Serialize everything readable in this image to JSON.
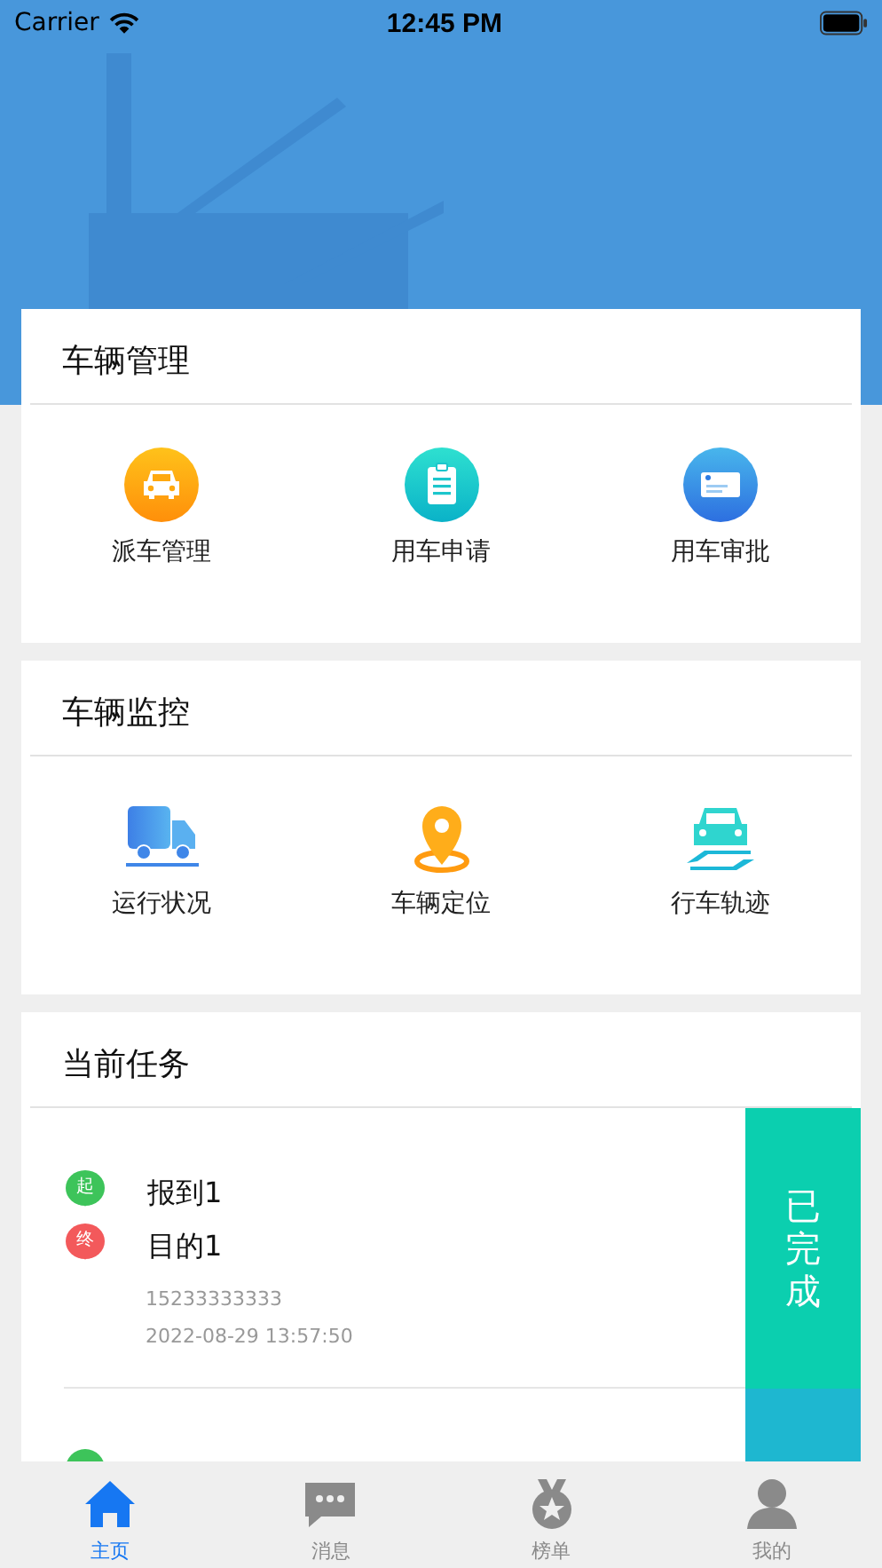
{
  "status_bar": {
    "carrier": "Carrier",
    "time": "12:45 PM"
  },
  "sections": [
    {
      "title": "车辆管理",
      "items": [
        {
          "label": "派车管理",
          "kind": "car"
        },
        {
          "label": "用车申请",
          "kind": "clipboard"
        },
        {
          "label": "用车审批",
          "kind": "card"
        }
      ]
    },
    {
      "title": "车辆监控",
      "items": [
        {
          "label": "运行状况",
          "kind": "truck"
        },
        {
          "label": "车辆定位",
          "kind": "pin"
        },
        {
          "label": "行车轨迹",
          "kind": "track"
        }
      ]
    }
  ],
  "tasks": {
    "title": "当前任务",
    "items": [
      {
        "start_marker": "起",
        "start": "报到1",
        "end_marker": "终",
        "end": "目的1",
        "phone": "15233333333",
        "time": "2022-08-29 13:57:50",
        "action": "已完成"
      }
    ]
  },
  "tab_bar": [
    {
      "label": "主页",
      "kind": "home",
      "selected": true
    },
    {
      "label": "消息",
      "kind": "chat",
      "selected": false
    },
    {
      "label": "榜单",
      "kind": "medal",
      "selected": false
    },
    {
      "label": "我的",
      "kind": "person",
      "selected": false
    }
  ]
}
